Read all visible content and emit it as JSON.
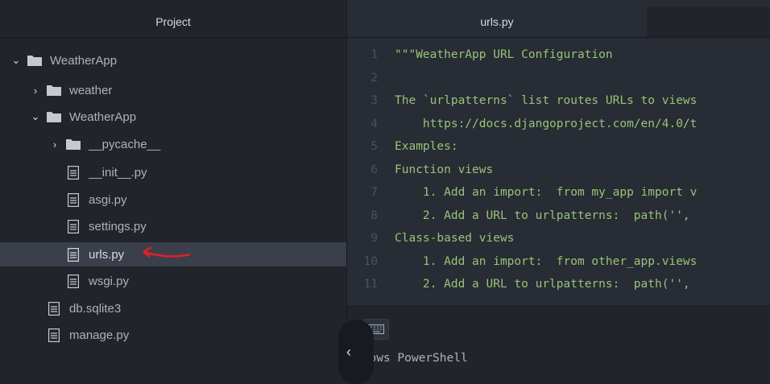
{
  "sidebar": {
    "header": "Project",
    "items": [
      {
        "label": "WeatherApp",
        "type": "folder",
        "expanded": true
      },
      {
        "label": "weather",
        "type": "folder",
        "expanded": false
      },
      {
        "label": "WeatherApp",
        "type": "folder",
        "expanded": true
      },
      {
        "label": "__pycache__",
        "type": "folder",
        "expanded": false
      },
      {
        "label": "__init__.py",
        "type": "file"
      },
      {
        "label": "asgi.py",
        "type": "file"
      },
      {
        "label": "settings.py",
        "type": "file"
      },
      {
        "label": "urls.py",
        "type": "file",
        "selected": true
      },
      {
        "label": "wsgi.py",
        "type": "file"
      },
      {
        "label": "db.sqlite3",
        "type": "file"
      },
      {
        "label": "manage.py",
        "type": "file"
      }
    ]
  },
  "editor": {
    "tab": "urls.py",
    "lines": [
      {
        "n": "1",
        "text": "\"\"\"WeatherApp URL Configuration"
      },
      {
        "n": "2",
        "text": ""
      },
      {
        "n": "3",
        "text": "The `urlpatterns` list routes URLs to views"
      },
      {
        "n": "4",
        "text": "    https://docs.djangoproject.com/en/4.0/t"
      },
      {
        "n": "5",
        "text": "Examples:"
      },
      {
        "n": "6",
        "text": "Function views"
      },
      {
        "n": "7",
        "text": "    1. Add an import:  from my_app import v"
      },
      {
        "n": "8",
        "text": "    2. Add a URL to urlpatterns:  path('',"
      },
      {
        "n": "9",
        "text": "Class-based views"
      },
      {
        "n": "10",
        "text": "    1. Add an import:  from other_app.views"
      },
      {
        "n": "11",
        "text": "    2. Add a URL to urlpatterns:  path('',"
      }
    ]
  },
  "terminal": {
    "text": "ndows PowerShell"
  },
  "colors": {
    "arrow": "#e0202a",
    "string": "#98c379"
  }
}
